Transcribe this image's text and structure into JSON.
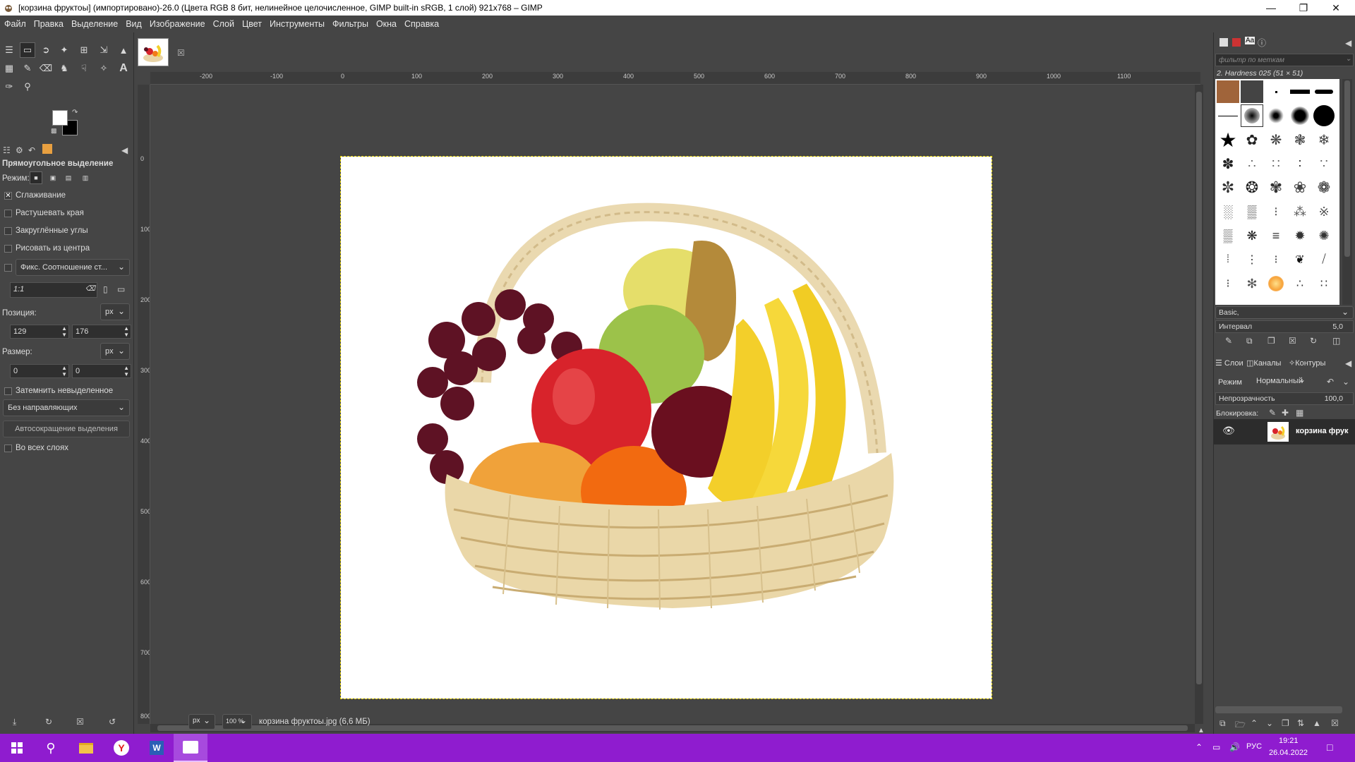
{
  "window": {
    "title": "[корзина фруктоы] (импортировано)-26.0 (Цвета RGB 8 бит, нелинейное целочисленное, GIMP built-in sRGB, 1 слой) 921x768 – GIMP"
  },
  "menu": [
    "Файл",
    "Правка",
    "Выделение",
    "Вид",
    "Изображение",
    "Слой",
    "Цвет",
    "Инструменты",
    "Фильтры",
    "Окна",
    "Справка"
  ],
  "tool_options": {
    "title": "Прямоугольное выделение",
    "mode_label": "Режим:",
    "antialias": "Сглаживание",
    "feather": "Растушевать края",
    "rounded": "Закруглённые углы",
    "from_center": "Рисовать из центра",
    "fixed_combo": "Фикс. Соотношение ст...",
    "ratio": "1:1",
    "position_label": "Позиция:",
    "position_unit": "px",
    "pos_x": "129",
    "pos_y": "176",
    "size_label": "Размер:",
    "size_unit": "px",
    "size_w": "0",
    "size_h": "0",
    "shade": "Затемнить невыделенное",
    "guides": "Без направляющих",
    "autoshrink": "Автосокращение выделения",
    "all_layers": "Во всех слоях"
  },
  "ruler": {
    "h_ticks": [
      "-200",
      "-100",
      "0",
      "100",
      "200",
      "300",
      "400",
      "500",
      "600",
      "700",
      "800",
      "900",
      "1000",
      "1100"
    ],
    "v_ticks": [
      "0",
      "100",
      "200",
      "300",
      "400",
      "500",
      "600",
      "700",
      "800"
    ]
  },
  "status": {
    "unit": "px",
    "zoom": "100 %",
    "file": "корзина фруктоы.jpg (6,6 МБ)"
  },
  "brushes": {
    "filter_placeholder": "фильтр по меткам",
    "current": "2. Hardness 025 (51 × 51)",
    "preset": "Basic,",
    "spacing_label": "Интервал",
    "spacing_value": "5,0"
  },
  "layers": {
    "tabs": [
      "Слои",
      "Каналы",
      "Контуры"
    ],
    "mode_label": "Режим",
    "mode_value": "Нормальный",
    "opacity_label": "Непрозрачность",
    "opacity_value": "100,0",
    "lock_label": "Блокировка:",
    "layer_name": "корзина фрук"
  },
  "taskbar": {
    "lang": "РУС",
    "time": "19:21",
    "date": "26.04.2022"
  }
}
